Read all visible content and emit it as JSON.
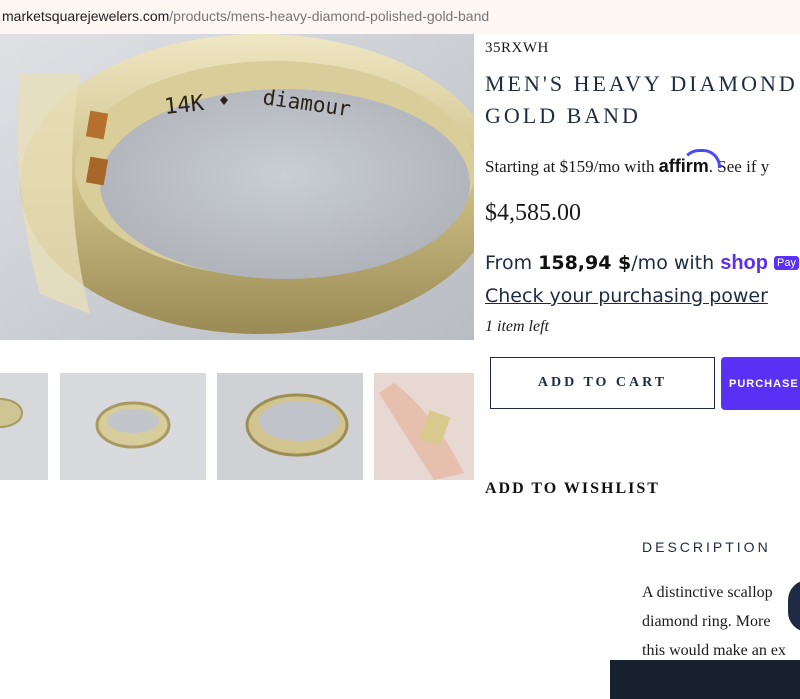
{
  "browser": {
    "url_domain": "marketsquarejewelers.com",
    "url_path": "/products/mens-heavy-diamond-polished-gold-band"
  },
  "gallery": {
    "main_image": "ring-interior-14k-diamour",
    "engraving_left": "14K",
    "engraving_right": "diamour",
    "thumbnails": [
      "ring-side",
      "ring-front",
      "ring-interior",
      "ring-on-hand"
    ]
  },
  "product": {
    "sku": "35RXWH",
    "title_line1": "MEN'S HEAVY DIAMOND",
    "title_line2": "GOLD BAND",
    "affirm_prefix": "Starting at $159/mo with ",
    "affirm_brand": "affirm",
    "affirm_suffix": ". See if y",
    "price": "$4,585.00",
    "shop_from": "From ",
    "shop_amount": "158,94 $",
    "shop_suffix": "/mo with ",
    "shop_brand": "shop",
    "shop_pay_badge": "Pay",
    "purchasing_power_link": "Check your purchasing power",
    "stock": "1 item left"
  },
  "actions": {
    "add_to_cart": "ADD TO CART",
    "buy_now": "PURCHASE W",
    "wishlist": "ADD TO WISHLIST"
  },
  "description": {
    "heading": "DESCRIPTION",
    "line1": "A distinctive scallop",
    "line2": "diamond ring. More",
    "line3": "this would make an ex"
  },
  "colors": {
    "accent": "#5a31f4",
    "navy": "#1f2a44"
  }
}
